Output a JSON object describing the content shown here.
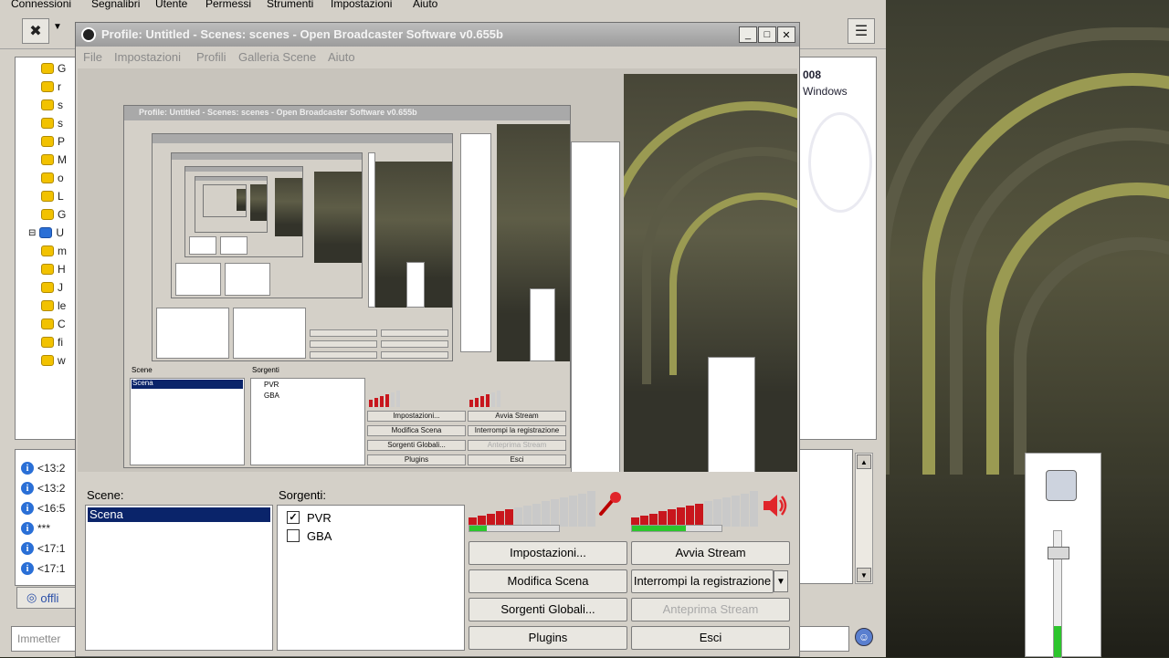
{
  "host": {
    "menu": [
      "Connessioni",
      "Segnalibri",
      "Utente",
      "Permessi",
      "Strumenti",
      "Impostazioni",
      "Aiuto"
    ],
    "tree_letters": [
      "G",
      "r",
      "s",
      "s",
      "P",
      "M",
      "o",
      "L",
      "G",
      "U",
      "m",
      "H",
      "J",
      "le",
      "C",
      "fi",
      "w"
    ],
    "log_lines": [
      "<13:2",
      "<13:2",
      "<16:5",
      "***",
      "<17:1",
      "<17:1"
    ],
    "status_tab": "offli",
    "input_placeholder": "Immetter",
    "right_text_1": "008",
    "right_text_2": "Windows"
  },
  "obs": {
    "title": "Profile: Untitled - Scenes: scenes - Open Broadcaster Software v0.655b",
    "menu": [
      "File",
      "Impostazioni",
      "Profili",
      "Galleria Scene",
      "Aiuto"
    ],
    "scenes_label": "Scene:",
    "sources_label": "Sorgenti:",
    "scenes": [
      "Scena"
    ],
    "sources": [
      {
        "name": "PVR",
        "checked": true
      },
      {
        "name": "GBA",
        "checked": false
      }
    ],
    "buttons": {
      "settings": "Impostazioni...",
      "start_stream": "Avvia Stream",
      "edit_scene": "Modifica Scena",
      "stop_recording": "Interrompi la registrazione",
      "global_sources": "Sorgenti Globali...",
      "preview_stream": "Anteprima Stream",
      "plugins": "Plugins",
      "exit": "Esci"
    },
    "mic_level": 0.33,
    "desktop_level": 0.6,
    "nested": {
      "title": "Profile: Untitled - Scenes: scenes - Open Broadcaster Software v0.655b",
      "scenes_label": "Scene",
      "sources_label": "Sorgenti",
      "scene": "Scena",
      "src1": "PVR",
      "src2": "GBA",
      "b1": "Impostazioni...",
      "b2": "Avvia Stream",
      "b3": "Modifica Scena",
      "b4": "Interrompi la registrazione",
      "b5": "Sorgenti Globali...",
      "b6": "Anteprima Stream",
      "b7": "Plugins",
      "b8": "Esci"
    }
  },
  "colors": {
    "accent_selection": "#0a246a",
    "meter_red": "#c8161d",
    "meter_green": "#2cc52c",
    "window_face": "#d4d0c8"
  },
  "icons": {
    "mic": "microphone-icon",
    "speaker": "speaker-icon"
  },
  "game_volume_level": 0.25
}
